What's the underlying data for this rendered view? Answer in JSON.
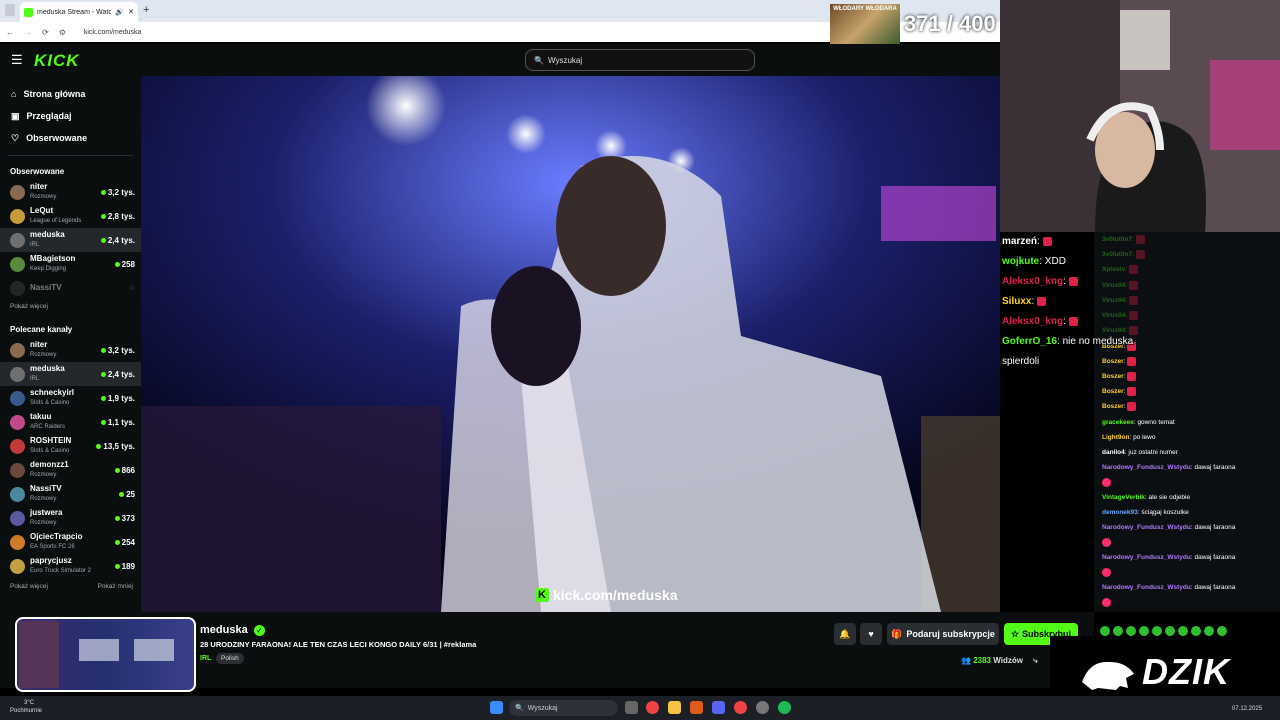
{
  "browser": {
    "tab_title": "meduska Stream - Watch L",
    "new_tab": "+",
    "url": "kick.com/meduska"
  },
  "goal_overlay": {
    "banner_text": "WŁODARY WŁODARA",
    "count": "371 / 400"
  },
  "header": {
    "logo": "KICK",
    "search_placeholder": "Wyszukaj"
  },
  "sidebar": {
    "nav": [
      {
        "label": "Strona główna",
        "icon": "home-icon"
      },
      {
        "label": "Przeglądaj",
        "icon": "browse-icon"
      },
      {
        "label": "Obserwowane",
        "icon": "heart-icon"
      }
    ],
    "followed_title": "Obserwowane",
    "followed": [
      {
        "name": "niter",
        "cat": "Rozmowy",
        "viewers": "3,2 tys.",
        "color": "#8a6a50"
      },
      {
        "name": "LeQut",
        "cat": "League of Legends",
        "viewers": "2,8 tys.",
        "color": "#c79a3a"
      },
      {
        "name": "meduska",
        "cat": "IRL",
        "viewers": "2,4 tys.",
        "color": "#6f6f6f"
      },
      {
        "name": "MBagietson",
        "cat": "Keep Digging",
        "viewers": "258",
        "color": "#5a8a3a"
      },
      {
        "name": "NassiTV",
        "cat": "",
        "viewers": "",
        "color": "#444"
      }
    ],
    "show_more_1": "Pokaż więcej",
    "recommended_title": "Polecane kanały",
    "recommended": [
      {
        "name": "niter",
        "cat": "Rozmowy",
        "viewers": "3,2 tys.",
        "color": "#8a6a50"
      },
      {
        "name": "meduska",
        "cat": "IRL",
        "viewers": "2,4 tys.",
        "color": "#6f6f6f"
      },
      {
        "name": "schneckyirl",
        "cat": "Slots & Casino",
        "viewers": "1,9 tys.",
        "color": "#3a5a8a"
      },
      {
        "name": "takuu",
        "cat": "ARC Raiders",
        "viewers": "1,1 tys.",
        "color": "#c24a8a"
      },
      {
        "name": "ROSHTEIN",
        "cat": "Slots & Casino",
        "viewers": "13,5 tys.",
        "color": "#c23a3a"
      },
      {
        "name": "demonzz1",
        "cat": "Rozmowy",
        "viewers": "866",
        "color": "#6a4a3a"
      },
      {
        "name": "NassiTV",
        "cat": "Rozmowy",
        "viewers": "25",
        "color": "#4a8aa0"
      },
      {
        "name": "justwera",
        "cat": "Rozmowy",
        "viewers": "373",
        "color": "#5a5aa0"
      },
      {
        "name": "OjciecTrapcio",
        "cat": "EA Sports FC 26",
        "viewers": "254",
        "color": "#d07a2a"
      },
      {
        "name": "paprycjusz",
        "cat": "Euro Truck Simulator 2",
        "viewers": "189",
        "color": "#c0a040"
      }
    ],
    "show_more_2": "Pokaż więcej",
    "show_less": "Pokaż mniej"
  },
  "video": {
    "watermark": "kick.com/meduska"
  },
  "overlay_chat": [
    {
      "user": "marzeń",
      "msg": "",
      "color": "#ffffff",
      "emote": "sun"
    },
    {
      "user": "wojkute",
      "msg": "XDD",
      "color": "#53fc18",
      "emote": ""
    },
    {
      "user": "Aleksx0_kng",
      "msg": "",
      "color": "#e0224a",
      "emote": ""
    },
    {
      "user": "Siluxx",
      "msg": "",
      "color": "#ffd21f",
      "emote": "face"
    },
    {
      "user": "Aleksx0_kng",
      "msg": "",
      "color": "#e0224a",
      "emote": ""
    },
    {
      "user": "GoferrO_16",
      "msg": "nie no meduska spierdoli",
      "color": "#53fc18",
      "emote": ""
    }
  ],
  "chat": [
    {
      "user": "3v0lut0n7",
      "msg": "",
      "color": "#53fc18"
    },
    {
      "user": "3v0lut0n7",
      "msg": "",
      "color": "#53fc18"
    },
    {
      "user": "Xplosiv",
      "msg": "",
      "color": "#53fc18"
    },
    {
      "user": "Virus94",
      "msg": "",
      "color": "#53fc18"
    },
    {
      "user": "Virus94",
      "msg": "",
      "color": "#53fc18"
    },
    {
      "user": "Virus94",
      "msg": "",
      "color": "#53fc18"
    },
    {
      "user": "Virus94",
      "msg": "",
      "color": "#53fc18"
    },
    {
      "user": "Boszer",
      "msg": "",
      "color": "#ffd21f"
    },
    {
      "user": "Boszer",
      "msg": "",
      "color": "#ffd21f"
    },
    {
      "user": "Boszer",
      "msg": "",
      "color": "#ffd21f"
    },
    {
      "user": "Boszer",
      "msg": "",
      "color": "#ffd21f"
    },
    {
      "user": "Boszer",
      "msg": "",
      "color": "#ffd21f"
    },
    {
      "user": "gracekeee",
      "msg": "gowno temat",
      "color": "#53fc18"
    },
    {
      "user": "Light9on",
      "msg": "po lewo",
      "color": "#ffd21f"
    },
    {
      "user": "danilo4",
      "msg": "juz ostatni numer",
      "color": "#ffffff"
    },
    {
      "user": "Narodowy_Fundusz_Wstydu",
      "msg": "dawaj faraona",
      "color": "#b07aff"
    },
    {
      "user": "VintageVerbik",
      "msg": "ale sie odjebie",
      "color": "#53fc18"
    },
    {
      "user": "demonek93",
      "msg": "ściągaj koszulke",
      "color": "#6aa7ff"
    },
    {
      "user": "Narodowy_Fundusz_Wstydu",
      "msg": "dawaj faraona",
      "color": "#b07aff"
    },
    {
      "user": "Narodowy_Fundusz_Wstydu",
      "msg": "dawaj faraona",
      "color": "#b07aff"
    },
    {
      "user": "Narodowy_Fundusz_Wstydu",
      "msg": "dawaj faraona",
      "color": "#b07aff"
    }
  ],
  "stream": {
    "streamer": "meduska",
    "title": "28 URODZINY FARAONA! ALE TEN CZAS LECI KONGO DAILY 6/31 | #reklama",
    "category": "IRL",
    "language": "Polish",
    "viewers_count": "2383",
    "viewers_label": "Widzów",
    "gift_label": "Podaruj subskrypcje",
    "sub_label": "Subskrybuj"
  },
  "sponsor": {
    "text": "DZIK"
  },
  "taskbar": {
    "temp": "3°C",
    "weather": "Pochmurnie",
    "search": "Wyszukaj",
    "date": "07.12.2025"
  },
  "colors": {
    "accent": "#53fc18",
    "bg": "#0b0e0f"
  }
}
